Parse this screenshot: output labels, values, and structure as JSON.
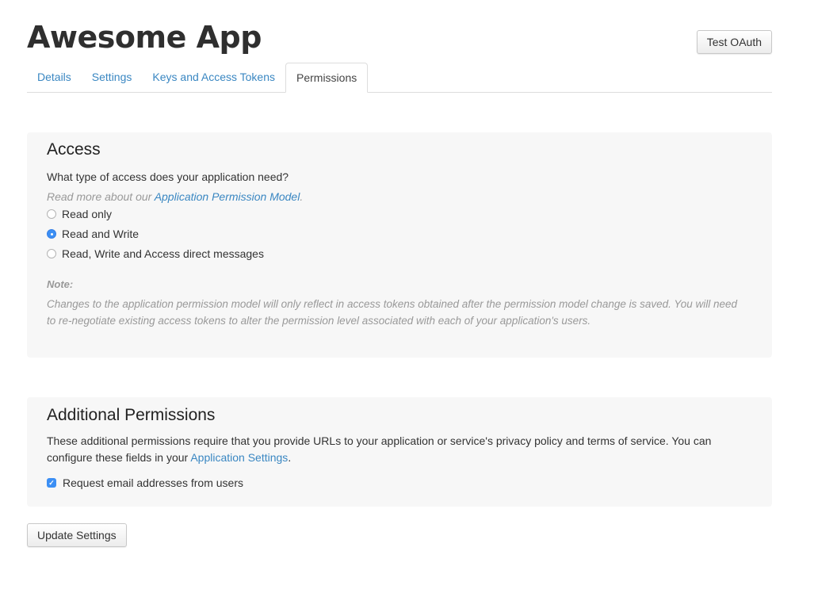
{
  "header": {
    "title": "Awesome App",
    "test_oauth_label": "Test OAuth"
  },
  "tabs": [
    {
      "label": "Details",
      "active": false
    },
    {
      "label": "Settings",
      "active": false
    },
    {
      "label": "Keys and Access Tokens",
      "active": false
    },
    {
      "label": "Permissions",
      "active": true
    }
  ],
  "access": {
    "title": "Access",
    "question": "What type of access does your application need?",
    "read_more_prefix": "Read more about our ",
    "read_more_link": "Application Permission Model",
    "read_more_suffix": ".",
    "options": [
      {
        "label": "Read only",
        "checked": false
      },
      {
        "label": "Read and Write",
        "checked": true
      },
      {
        "label": "Read, Write and Access direct messages",
        "checked": false
      }
    ],
    "note_label": "Note:",
    "note_text": "Changes to the application permission model will only reflect in access tokens obtained after the permission model change is saved. You will need to re-negotiate existing access tokens to alter the permission level associated with each of your application's users."
  },
  "additional": {
    "title": "Additional Permissions",
    "text_prefix": "These additional permissions require that you provide URLs to your application or service's privacy policy and terms of service. You can configure these fields in your ",
    "text_link": "Application Settings",
    "text_suffix": ".",
    "checkbox_label": "Request email addresses from users",
    "checkbox_checked": true
  },
  "footer": {
    "update_label": "Update Settings"
  },
  "colors": {
    "accent": "#3c8ff4",
    "link": "#3a87c2",
    "panel_bg": "#f7f7f7"
  }
}
